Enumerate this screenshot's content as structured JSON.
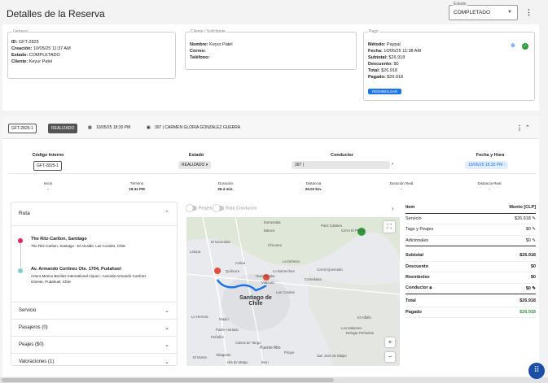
{
  "page": {
    "title": "Detalles de la Reserva"
  },
  "state_select": {
    "legend": "Estado",
    "value": "COMPLETADO"
  },
  "general": {
    "legend": "General",
    "id_label": "ID:",
    "id": "GFT-2825",
    "created_label": "Creación:",
    "created": "10/05/25 11:37 AM",
    "state_label": "Estado:",
    "state": "COMPLETADO",
    "client_label": "Cliente:",
    "client": "Keyur Patel"
  },
  "client_box": {
    "legend": "Cliente / Solicitante",
    "name_label": "Nombre:",
    "name": "Keyur Patel",
    "email_label": "Correo:",
    "email": "",
    "phone_label": "Teléfono:",
    "phone": ""
  },
  "payment": {
    "legend": "Pago",
    "method_label": "Método:",
    "method": "Paypal",
    "date_label": "Fecha:",
    "date": "10/05/25 11:38 AM",
    "subtotal_label": "Subtotal:",
    "subtotal": "$26.918",
    "discount_label": "Descuento:",
    "discount": "$0",
    "total_label": "Total:",
    "total": "$26.918",
    "paid_label": "Pagado:",
    "paid": "$26.918",
    "refund_button": "REEMBOLSAR",
    "colors": {
      "accent": "#1a73e8",
      "success": "#2e9b3a"
    }
  },
  "trip": {
    "code_chip": "GFT-2825-1",
    "status_chip": "REALIZADO",
    "datetime": "10/05/25 18:30 PM",
    "vehicle_driver": "397 | CARMEN GLORIA GONZALEZ GUERRA",
    "internal_code_label": "Código Interno",
    "internal_code": "GFT-2825-1",
    "state_label": "Estado",
    "state": "REALIZADO",
    "driver_label": "Conductor",
    "driver": "397 |",
    "datetime_label": "Fecha y Hora",
    "datetime_value": "10/05/25 18:30 PM",
    "metrics": [
      {
        "label": "Inicio",
        "value": "-"
      },
      {
        "label": "Término",
        "value": "19:41 PM"
      },
      {
        "label": "Duración",
        "value": "26.4 min."
      },
      {
        "label": "Distancia",
        "value": "25.03 km."
      },
      {
        "label": "Duración Real",
        "value": "-"
      },
      {
        "label": "Distancia Real",
        "value": "-"
      }
    ]
  },
  "route": {
    "title": "Ruta",
    "origin_name": "The Ritz-Carlton, Santiago",
    "origin_addr": "The Ritz-Carlton, Santiago - El Alcalde, Las Condes, Chile",
    "dest_name": "Av. Armando Cortinez Ote. 1704, Pudahuel",
    "dest_addr_1": "Arturo Merino Benítez International Airport - Avenida Armando Cortínez",
    "dest_addr_2": "Oriente, Pudahuel, Chile",
    "sections": [
      "Servicio",
      "Pasajeros (0)",
      "Peajes ($0)",
      "Valoraciones (1)"
    ]
  },
  "map": {
    "toggle_tolls": "Peajes",
    "toggle_driver": "Ruta Conductor",
    "zoom_in": "+",
    "zoom_out": "−",
    "places": [
      "Esmeralda",
      "Pierz Caldera",
      "Cerro El Plomo",
      "Batuco",
      "Lampa",
      "La Dehesa",
      "Colina",
      "Lo Barnechea",
      "Santiago de Chile",
      "Maipú",
      "Puente Alto",
      "Talagante",
      "Peñaflor",
      "Pirque",
      "El Alfalfa",
      "Los Maitenes",
      "Refugio Peñuelas",
      "San José de Maipo",
      "Corral Quemado",
      "Corneliana",
      "Las Condes",
      "Vitacura",
      "Quilicura",
      "Huechuraba",
      "Chicureo",
      "Padre Hurtado",
      "Buin",
      "Calera de Tango",
      "El Monte",
      "Isla de Maipo",
      "Lo Herrera",
      "El Noviciado"
    ]
  },
  "pricing": {
    "col_item": "Item",
    "col_amount": "Monto [CLP]",
    "rows": [
      {
        "label": "Servicio",
        "amount": "$26.918"
      },
      {
        "label": "Tags y Peajes",
        "amount": "$0"
      },
      {
        "label": "Adicionales",
        "amount": "$0"
      }
    ],
    "subtotal_label": "Subtotal",
    "subtotal": "$26.918",
    "discount_label": "Descuento",
    "discount": "$0",
    "refund_label": "Reembolso",
    "refund": "$0",
    "driver_label": "Conductor",
    "driver": "$0",
    "total_label": "Total",
    "total": "$26.918",
    "paid_label": "Pagado",
    "paid": "$26.918"
  }
}
